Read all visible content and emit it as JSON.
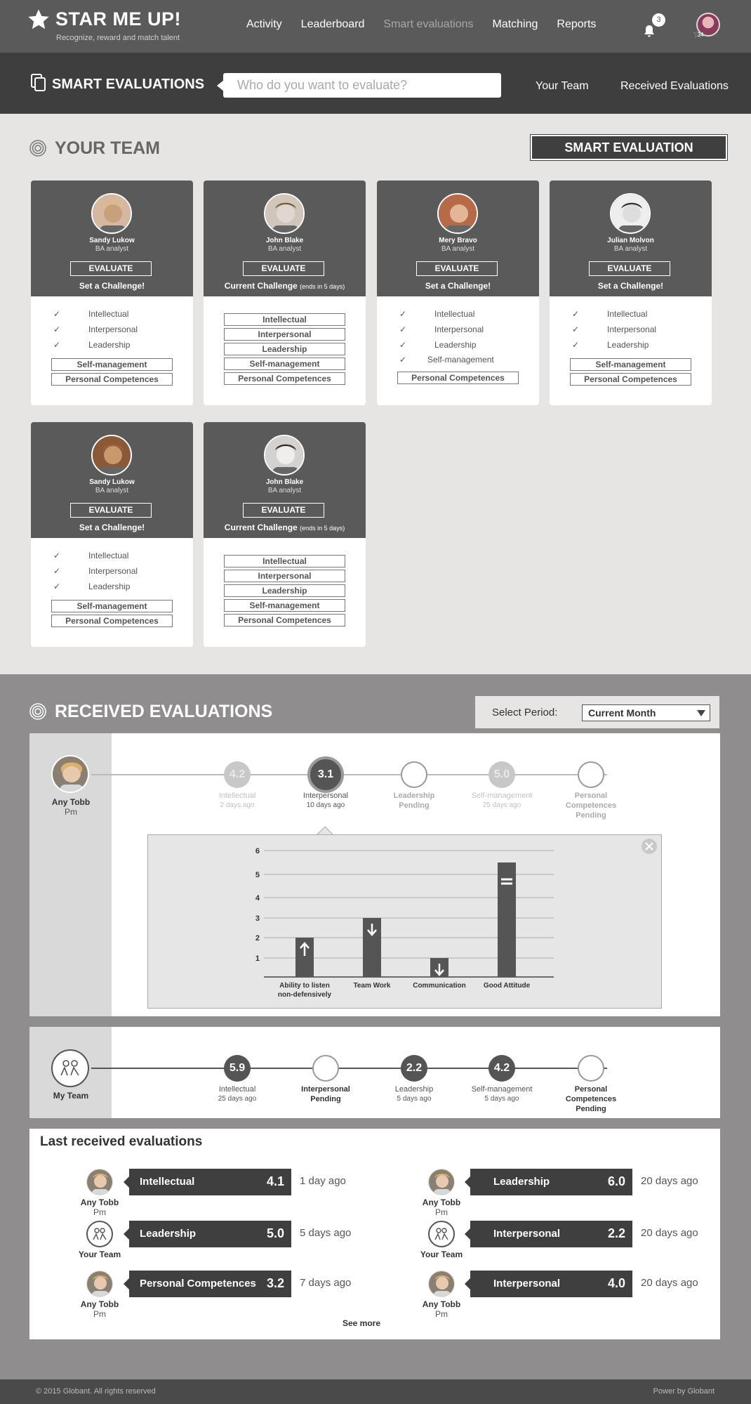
{
  "app": {
    "title": "STAR ME UP!",
    "tagline": "Recognize, reward and match talent",
    "nav": [
      "Activity",
      "Leaderboard",
      "Smart evaluations",
      "Matching",
      "Reports"
    ],
    "notifications": "3",
    "user_score": "34"
  },
  "subheader": {
    "title": "SMART EVALUATIONS",
    "search_placeholder": "Who do you want to evaluate?",
    "links": [
      "Your Team",
      "Received Evaluations"
    ]
  },
  "team": {
    "title": "YOUR TEAM",
    "button": "SMART EVALUATION",
    "evaluate_label": "EVALUATE",
    "cards": [
      {
        "name": "Sandy Lukow",
        "role": "BA analyst",
        "challenge": "Set a Challenge!",
        "challenge_note": "",
        "checked": [
          "Intellectual",
          "Interpersonal",
          "Leadership"
        ],
        "boxed": [
          "Self-management",
          "Personal Competences"
        ]
      },
      {
        "name": "John Blake",
        "role": "BA analyst",
        "challenge": "Current Challenge",
        "challenge_note": "(ends in 5 days)",
        "checked": [],
        "boxed": [
          "Intellectual",
          "Interpersonal",
          "Leadership",
          "Self-management",
          "Personal Competences"
        ]
      },
      {
        "name": "Mery Bravo",
        "role": "BA analyst",
        "challenge": "Set a Challenge!",
        "challenge_note": "",
        "checked": [
          "Intellectual",
          "Interpersonal",
          "Leadership",
          "Self-management"
        ],
        "boxed": [
          "Personal Competences"
        ]
      },
      {
        "name": "Julian Molvon",
        "role": "BA analyst",
        "challenge": "Set a Challenge!",
        "challenge_note": "",
        "checked": [
          "Intellectual",
          "Interpersonal",
          "Leadership"
        ],
        "boxed": [
          "Self-management",
          "Personal Competences"
        ]
      },
      {
        "name": "Sandy Lukow",
        "role": "BA analyst",
        "challenge": "Set a Challenge!",
        "challenge_note": "",
        "checked": [
          "Intellectual",
          "Interpersonal",
          "Leadership"
        ],
        "boxed": [
          "Self-management",
          "Personal Competences"
        ]
      },
      {
        "name": "John Blake",
        "role": "BA analyst",
        "challenge": "Current Challenge",
        "challenge_note": "(ends in 5 days)",
        "checked": [],
        "boxed": [
          "Intellectual",
          "Interpersonal",
          "Leadership",
          "Self-management",
          "Personal Competences"
        ]
      }
    ]
  },
  "received": {
    "title": "RECEIVED EVALUATIONS",
    "period_label": "Select Period:",
    "period_value": "Current Month",
    "person": {
      "name": "Any Tobb",
      "role": "Pm"
    },
    "timeline": [
      {
        "score": "4.2",
        "label": "Intellectual",
        "sub": "2 days ago",
        "state": "faded"
      },
      {
        "score": "3.1",
        "label": "Interpersonal",
        "sub": "10 days ago",
        "state": "active"
      },
      {
        "score": "",
        "label": "Leadership",
        "sub": "Pending",
        "state": "empty"
      },
      {
        "score": "5.0",
        "label": "Self-management",
        "sub": "25 days ago",
        "state": "faded"
      },
      {
        "score": "",
        "label": "Personal Competences",
        "sub": "Pending",
        "state": "empty"
      }
    ],
    "team": {
      "name": "My Team"
    },
    "team_timeline": [
      {
        "score": "5.9",
        "label": "Intellectual",
        "sub": "25 days ago",
        "state": "dark"
      },
      {
        "score": "",
        "label": "Interpersonal",
        "sub": "Pending",
        "state": "empty"
      },
      {
        "score": "2.2",
        "label": "Leadership",
        "sub": "5 days ago",
        "state": "dark"
      },
      {
        "score": "4.2",
        "label": "Self-management",
        "sub": "5 days ago",
        "state": "dark"
      },
      {
        "score": "",
        "label": "Personal Competences",
        "sub": "Pending",
        "state": "empty"
      }
    ],
    "last_title": "Last received evaluations",
    "see_more": "See more",
    "last": [
      {
        "who": "Any Tobb",
        "role": "Pm",
        "kind": "person",
        "name": "Intellectual",
        "score": "4.1",
        "ago": "1 day ago"
      },
      {
        "who": "Any Tobb",
        "role": "Pm",
        "kind": "person",
        "name": "Leadership",
        "score": "6.0",
        "ago": "20 days ago"
      },
      {
        "who": "Your Team",
        "role": "",
        "kind": "team",
        "name": "Leadership",
        "score": "5.0",
        "ago": "5 days ago"
      },
      {
        "who": "Your Team",
        "role": "",
        "kind": "team",
        "name": "Interpersonal",
        "score": "2.2",
        "ago": "20 days ago"
      },
      {
        "who": "Any Tobb",
        "role": "Pm",
        "kind": "person",
        "name": "Personal Competences",
        "score": "3.2",
        "ago": "7 days ago"
      },
      {
        "who": "Any Tobb",
        "role": "Pm",
        "kind": "person",
        "name": "Interpersonal",
        "score": "4.0",
        "ago": "20 days ago"
      }
    ]
  },
  "chart_data": {
    "type": "bar",
    "categories": [
      "Ability to listen non-defensively",
      "Team Work",
      "Communication",
      "Good Attitude"
    ],
    "values": [
      2,
      3,
      1,
      5.5
    ],
    "trend": [
      "up",
      "down",
      "down",
      "equal"
    ],
    "ylim": [
      0,
      6
    ],
    "yticks": [
      1,
      2,
      3,
      4,
      5,
      6
    ],
    "grid": true
  },
  "footer": {
    "left": "© 2015 Globant. All rights reserved",
    "right": "Power by Globant"
  }
}
